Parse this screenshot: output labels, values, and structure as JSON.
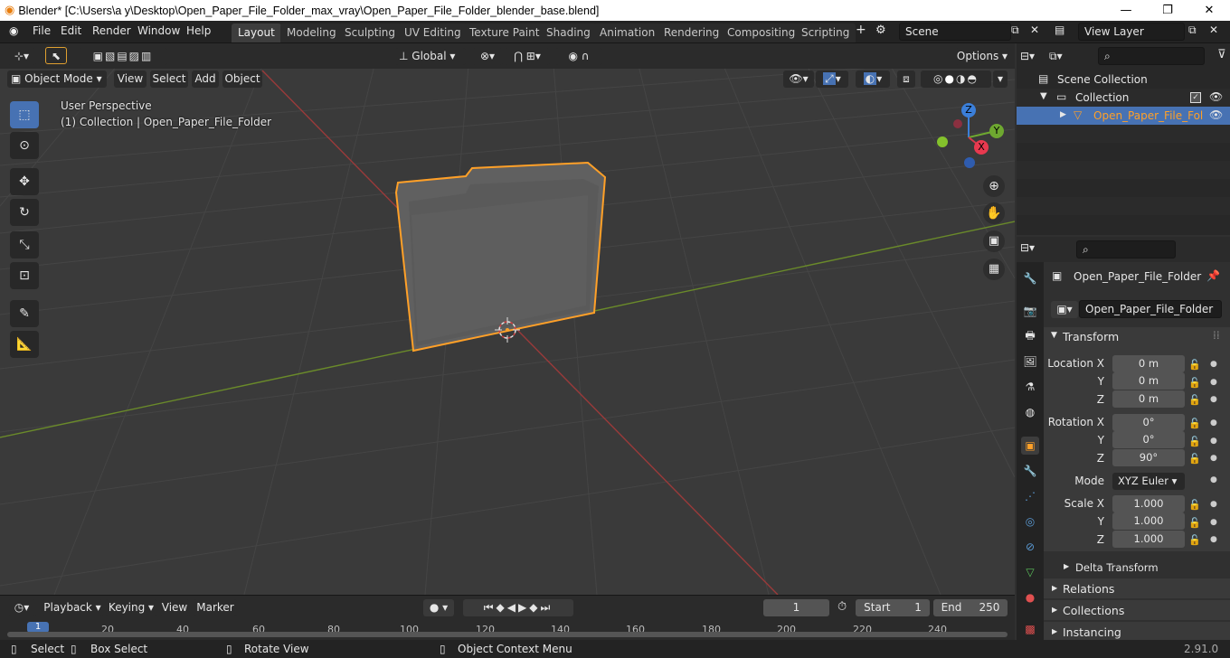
{
  "window": {
    "title": "Blender* [C:\\Users\\a y\\Desktop\\Open_Paper_File_Folder_max_vray\\Open_Paper_File_Folder_blender_base.blend]",
    "minimize": "—",
    "maximize": "❐",
    "close": "✕"
  },
  "menu": [
    "File",
    "Edit",
    "Render",
    "Window",
    "Help"
  ],
  "workspaces": [
    "Layout",
    "Modeling",
    "Sculpting",
    "UV Editing",
    "Texture Paint",
    "Shading",
    "Animation",
    "Rendering",
    "Compositing",
    "Scripting"
  ],
  "workspace_add": "+",
  "scene": {
    "label": "Scene"
  },
  "view_layer": {
    "label": "View Layer"
  },
  "viewport_header": {
    "transform_orientation": "Global",
    "options": "Options",
    "mode": "Object Mode",
    "menus": [
      "View",
      "Select",
      "Add",
      "Object"
    ]
  },
  "viewport": {
    "perspective": "User Perspective",
    "collection_info": "(1) Collection | Open_Paper_File_Folder"
  },
  "gizmo": {
    "x": "X",
    "y": "Y",
    "z": "Z"
  },
  "outliner": {
    "scene_collection": "Scene Collection",
    "collection": "Collection",
    "object": "Open_Paper_File_Fol"
  },
  "properties": {
    "object_name": "Open_Paper_File_Folder",
    "datablock": "Open_Paper_File_Folder",
    "transform_label": "Transform",
    "location_label": "Location X",
    "rotation_label": "Rotation X",
    "scale_label": "Scale X",
    "axis_y": "Y",
    "axis_z": "Z",
    "location": [
      "0 m",
      "0 m",
      "0 m"
    ],
    "rotation": [
      "0°",
      "0°",
      "90°"
    ],
    "mode_label": "Mode",
    "mode_value": "XYZ Euler",
    "scale": [
      "1.000",
      "1.000",
      "1.000"
    ],
    "delta_transform": "Delta Transform",
    "relations": "Relations",
    "collections": "Collections",
    "instancing": "Instancing"
  },
  "timeline": {
    "menus": [
      "Playback",
      "Keying",
      "View",
      "Marker"
    ],
    "current_frame": "1",
    "start_label": "Start",
    "start_value": "1",
    "end_label": "End",
    "end_value": "250",
    "ticks": [
      "20",
      "40",
      "60",
      "80",
      "100",
      "120",
      "140",
      "160",
      "180",
      "200",
      "220",
      "240"
    ],
    "playhead": "1"
  },
  "status": {
    "select": "Select",
    "box_select": "Box Select",
    "rotate_view": "Rotate View",
    "context_menu": "Object Context Menu",
    "version": "2.91.0"
  },
  "colors": {
    "accent": "#4772b3",
    "selection": "#ffa028",
    "axis_x": "#9a3a3a",
    "axis_y": "#6a8a2a"
  }
}
